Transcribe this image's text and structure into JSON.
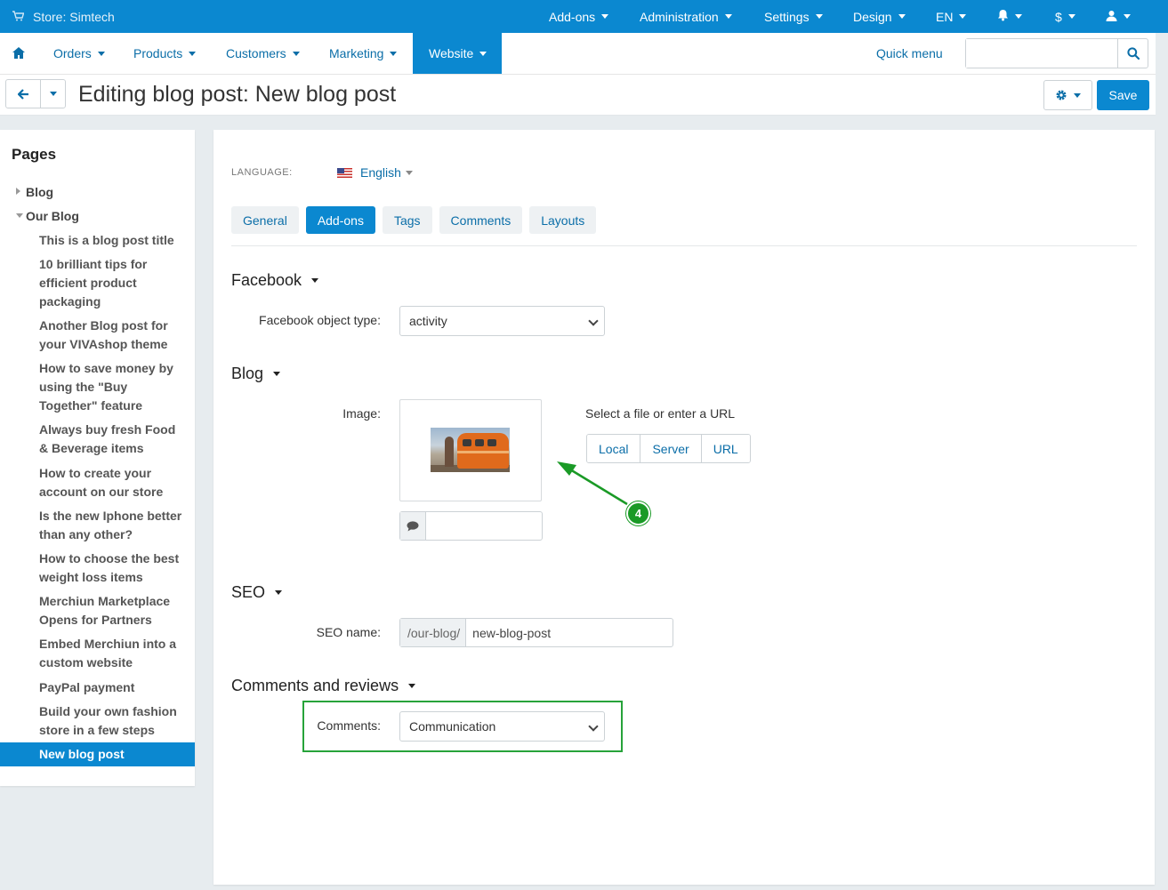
{
  "topbar": {
    "store_label": "Store: Simtech",
    "menu": [
      {
        "label": "Add-ons"
      },
      {
        "label": "Administration"
      },
      {
        "label": "Settings"
      },
      {
        "label": "Design"
      },
      {
        "label": "EN"
      },
      {
        "label": "$"
      }
    ]
  },
  "nav": {
    "items": [
      {
        "label": "Orders"
      },
      {
        "label": "Products"
      },
      {
        "label": "Customers"
      },
      {
        "label": "Marketing"
      },
      {
        "label": "Website"
      }
    ],
    "quick_menu": "Quick menu",
    "search": {
      "value": "",
      "placeholder": ""
    }
  },
  "titlebar": {
    "title": "Editing blog post: New blog post",
    "save_label": "Save"
  },
  "sidebar": {
    "title": "Pages",
    "nodes": [
      {
        "label": "Blog"
      },
      {
        "label": "Our Blog"
      }
    ],
    "children": [
      {
        "label": "This is a blog post title"
      },
      {
        "label": "10 brilliant tips for efficient product packaging"
      },
      {
        "label": "Another Blog post for your VIVAshop theme"
      },
      {
        "label": "How to save money by using the \"Buy Together\" feature"
      },
      {
        "label": "Always buy fresh Food & Beverage items"
      },
      {
        "label": "How to create your account on our store"
      },
      {
        "label": "Is the new Iphone better than any other?"
      },
      {
        "label": "How to choose the best weight loss items"
      },
      {
        "label": "Merchiun Marketplace Opens for Partners"
      },
      {
        "label": "Embed Merchiun into a custom website"
      },
      {
        "label": "PayPal payment"
      },
      {
        "label": "Build your own fashion store in a few steps"
      },
      {
        "label": "New blog post"
      }
    ]
  },
  "main": {
    "language_label": "LANGUAGE:",
    "language_value": "English",
    "tabs": [
      {
        "label": "General"
      },
      {
        "label": "Add-ons"
      },
      {
        "label": "Tags"
      },
      {
        "label": "Comments"
      },
      {
        "label": "Layouts"
      }
    ],
    "facebook": {
      "heading": "Facebook",
      "object_type_label": "Facebook object type:",
      "object_type_value": "activity"
    },
    "blog": {
      "heading": "Blog",
      "image_label": "Image:",
      "select_hint": "Select a file or enter a URL",
      "buttons": [
        {
          "label": "Local"
        },
        {
          "label": "Server"
        },
        {
          "label": "URL"
        }
      ],
      "alt_text_value": ""
    },
    "seo": {
      "heading": "SEO",
      "name_label": "SEO name:",
      "prefix": "/our-blog/",
      "value": "new-blog-post"
    },
    "comments": {
      "heading": "Comments and reviews",
      "label": "Comments:",
      "value": "Communication"
    }
  },
  "annotation": {
    "badge": "4",
    "color": "#1a9a26"
  },
  "colors": {
    "primary": "#0b88d0",
    "link": "#0b6ea8",
    "highlight": "#27a33a"
  }
}
